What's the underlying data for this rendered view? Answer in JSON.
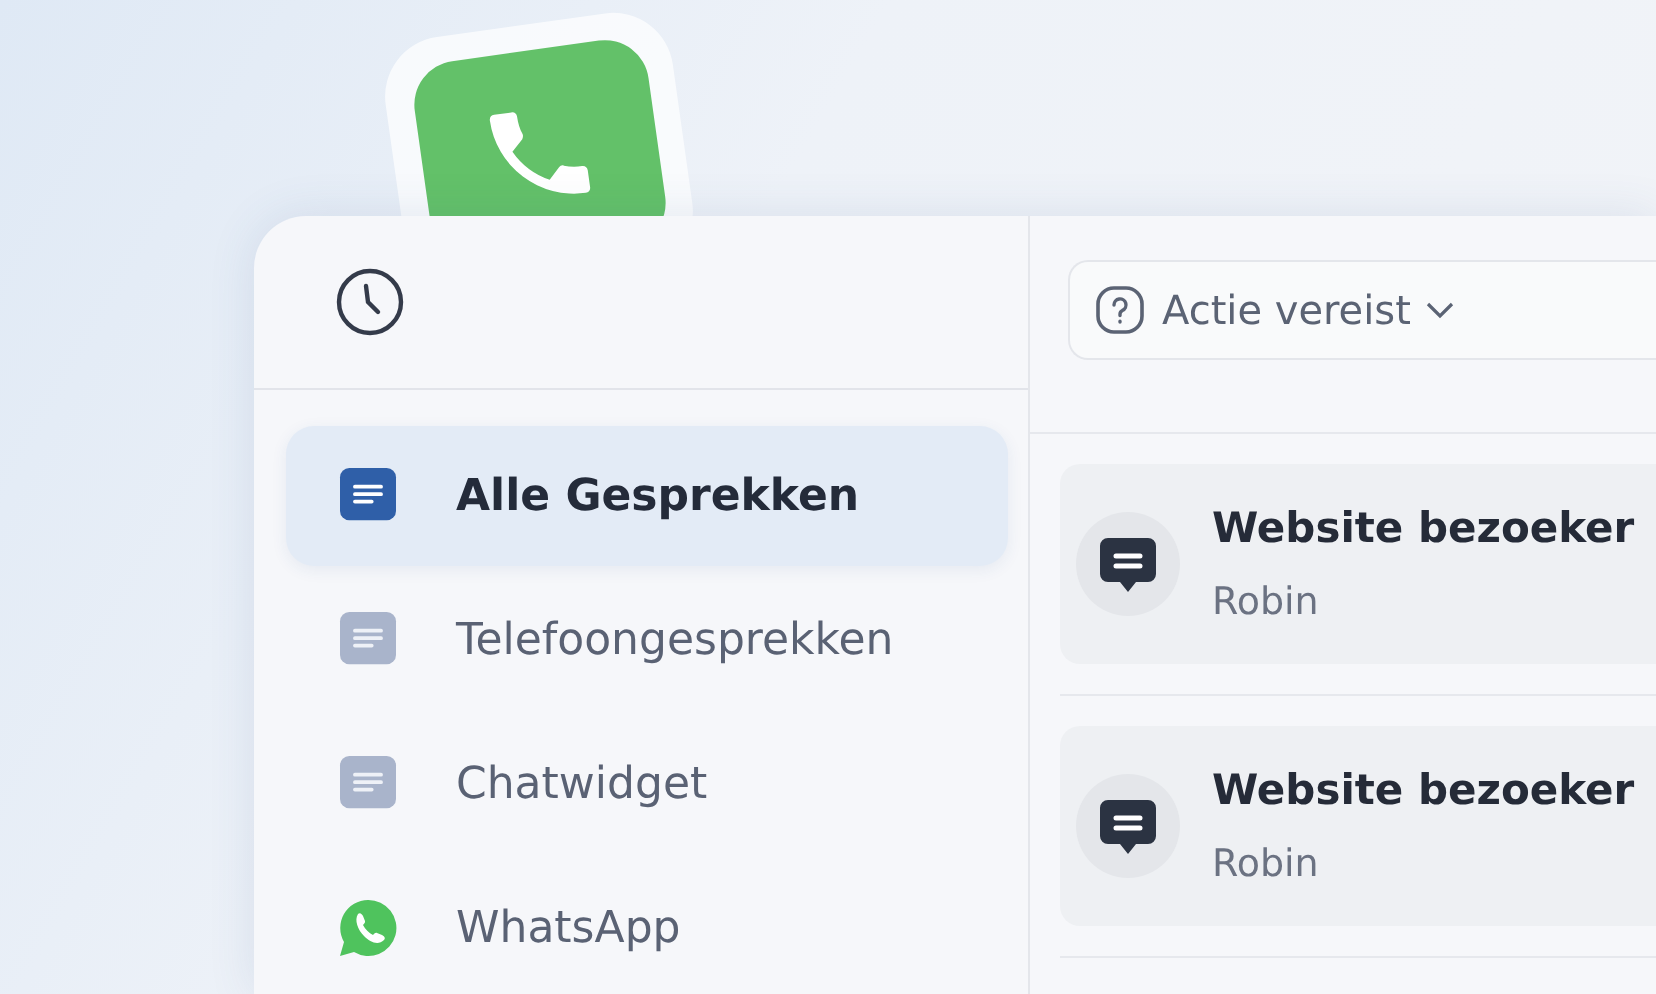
{
  "sidebar": {
    "items": [
      {
        "label": "Alle Gesprekken",
        "kind": "list",
        "selected": true
      },
      {
        "label": "Telefoongesprekken",
        "kind": "list",
        "selected": false
      },
      {
        "label": "Chatwidget",
        "kind": "list",
        "selected": false
      },
      {
        "label": "WhatsApp",
        "kind": "whatsapp",
        "selected": false
      }
    ]
  },
  "filter": {
    "label": "Actie vereist"
  },
  "conversations": [
    {
      "title": "Website bezoeker",
      "subtitle": "Robin"
    },
    {
      "title": "Website bezoeker",
      "subtitle": "Robin"
    }
  ]
}
